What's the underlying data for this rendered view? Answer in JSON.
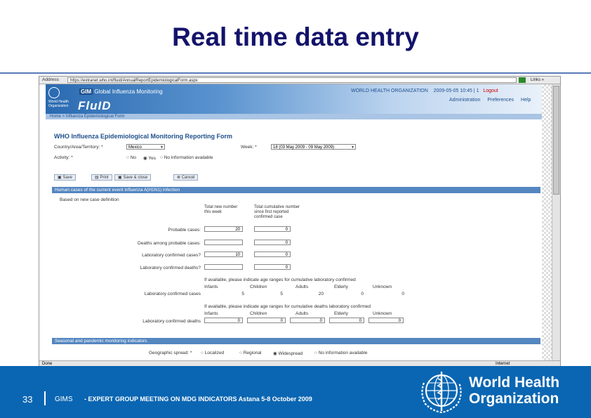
{
  "slide": {
    "title": "Real time data entry",
    "page_number": "33",
    "footer_org": "GIMS",
    "footer_meeting": "- EXPERT GROUP MEETING ON MDG INDICATORS Astana 5-8 October 2009",
    "who_line1": "World Health",
    "who_line2": "Organization"
  },
  "colors": {
    "title": "#13136b",
    "footer_bg": "#0a66b2",
    "section_header": "#5486c0"
  },
  "browser": {
    "address_label": "Address",
    "url": "https://extranet.who.int/fluid/AnnualReportEpidemiologicalForm.aspx",
    "links_label": "Links »",
    "status_done": "Done",
    "status_zone": "Internet"
  },
  "app": {
    "gim_label": "GIM",
    "gim_full": "Global Influenza Monitoring",
    "logo_text": "World Health Organization",
    "product": "FluID",
    "org_header": "WORLD HEALTH ORGANIZATION",
    "user_info": "2009-05-05 10:45 | 1",
    "logout": "Logout",
    "admin_link": "Administration",
    "prefs_link": "Preferences",
    "help_link": "Help",
    "breadcrumb": "Home > Influenza Epidemiological Form"
  },
  "form": {
    "title": "WHO Influenza Epidemiological Monitoring Reporting Form",
    "country_label": "Country/Area/Territory: *",
    "country_value": "Mexico",
    "week_label": "Week: *",
    "week_value": "18 (03 May 2009 - 09 May 2009)",
    "activity_label": "Activity: *",
    "activity_options": [
      "No",
      "Yes",
      "No information available"
    ],
    "buttons": {
      "save": "Save",
      "print": "Print",
      "save_close": "Save & close",
      "cancel": "Cancel"
    },
    "section1_title": "Human cases of the current event influenza A(H1N1) infection",
    "add_new_definition": "Based on new case definition",
    "col_total_week": "Total new number this week",
    "col_total_since": "Total cumulative number since first reported confirmed case",
    "rows": [
      {
        "label": "Probable cases:",
        "week": "20",
        "total": "0"
      },
      {
        "label": "Deaths among probable cases:",
        "week": "",
        "total": "0"
      },
      {
        "label": "Laboratory confirmed cases?",
        "week": "10",
        "total": "0"
      },
      {
        "label": "Laboratory confirmed deaths?",
        "week": "",
        "total": "0"
      }
    ],
    "cases_age_note": "If available, please indicate age ranges for cumulative laboratory confirmed",
    "deaths_age_note": "If available, please indicate age ranges for cumulative deaths laboratory confirmed",
    "age_headers": [
      "Infants",
      "Children",
      "Adults",
      "Elderly",
      "Unknown"
    ],
    "lab_confirmed_cases_label": "Laboratory confirmed cases",
    "lab_confirmed_cases_values": [
      "5",
      "5",
      "20",
      "0",
      "0"
    ],
    "lab_confirmed_deaths_label": "Laboratory confirmed deaths",
    "lab_confirmed_deaths_values": [
      "0",
      "0",
      "0",
      "0",
      "0"
    ],
    "section2_title": "Seasonal and pandemic monitoring indicators",
    "spread_label": "Geographic spread: *",
    "spread_options": [
      "Localized",
      "Regional",
      "Widespread",
      "No information available"
    ]
  }
}
